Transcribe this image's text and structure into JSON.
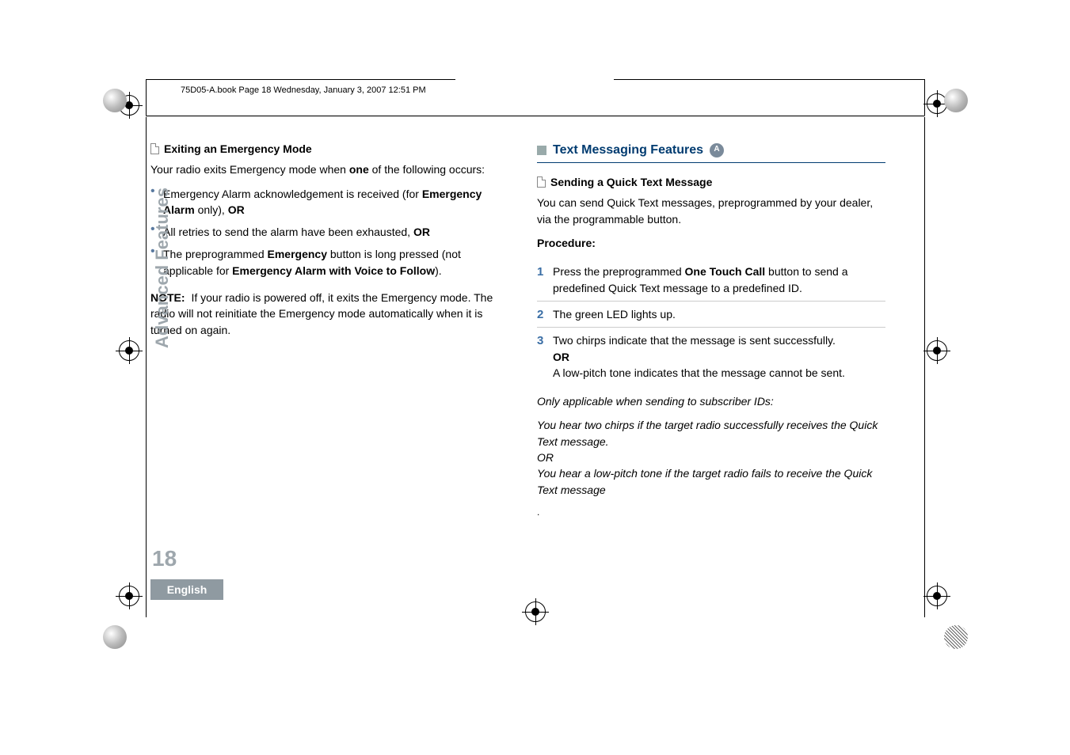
{
  "header_line": "75D05-A.book  Page 18  Wednesday, January 3, 2007  12:51 PM",
  "sidebar_label": "Advanced Features",
  "page_number": "18",
  "language": "English",
  "left": {
    "h3": "Exiting an Emergency Mode",
    "intro_pre": "Your radio exits Emergency mode when ",
    "intro_bold": "one",
    "intro_post": " of the following occurs:",
    "b1_pre": "Emergency Alarm acknowledgement is received (for ",
    "b1_bold": "Emergency Alarm",
    "b1_post": " only), ",
    "b1_or": "OR",
    "b2_pre": "All retries to send the alarm have been exhausted, ",
    "b2_or": "OR",
    "b3_pre": "The preprogrammed ",
    "b3_bold1": "Emergency",
    "b3_mid": " button is long pressed (not applicable for ",
    "b3_bold2": "Emergency Alarm with Voice to Follow",
    "b3_post": ").",
    "note_label": "NOTE:",
    "note_body": "If your radio is powered off, it exits the Emergency mode. The radio will not reinitiate the Emergency mode automatically when it is turned on again."
  },
  "right": {
    "h2": "Text Messaging Features",
    "h3": "Sending a Quick Text Message",
    "intro": "You can send Quick Text messages, preprogrammed by your dealer, via the programmable button.",
    "proc_label": "Procedure:",
    "s1_pre": "Press the preprogrammed ",
    "s1_bold": "One Touch Call",
    "s1_post": " button to send a predefined Quick Text message to a predefined ID.",
    "s2": "The green LED lights up.",
    "s3_a": "Two chirps indicate that the message is sent successfully.",
    "s3_or": "OR",
    "s3_b": "A low-pitch tone indicates that the message cannot be sent.",
    "ital1": "Only applicable when sending to subscriber IDs:",
    "ital2": "You hear two chirps if the target radio successfully receives the Quick Text message.",
    "ital_or": "OR",
    "ital3": "You hear a low-pitch tone if the target radio fails to receive the Quick Text message",
    "circ_glyph": "A"
  }
}
